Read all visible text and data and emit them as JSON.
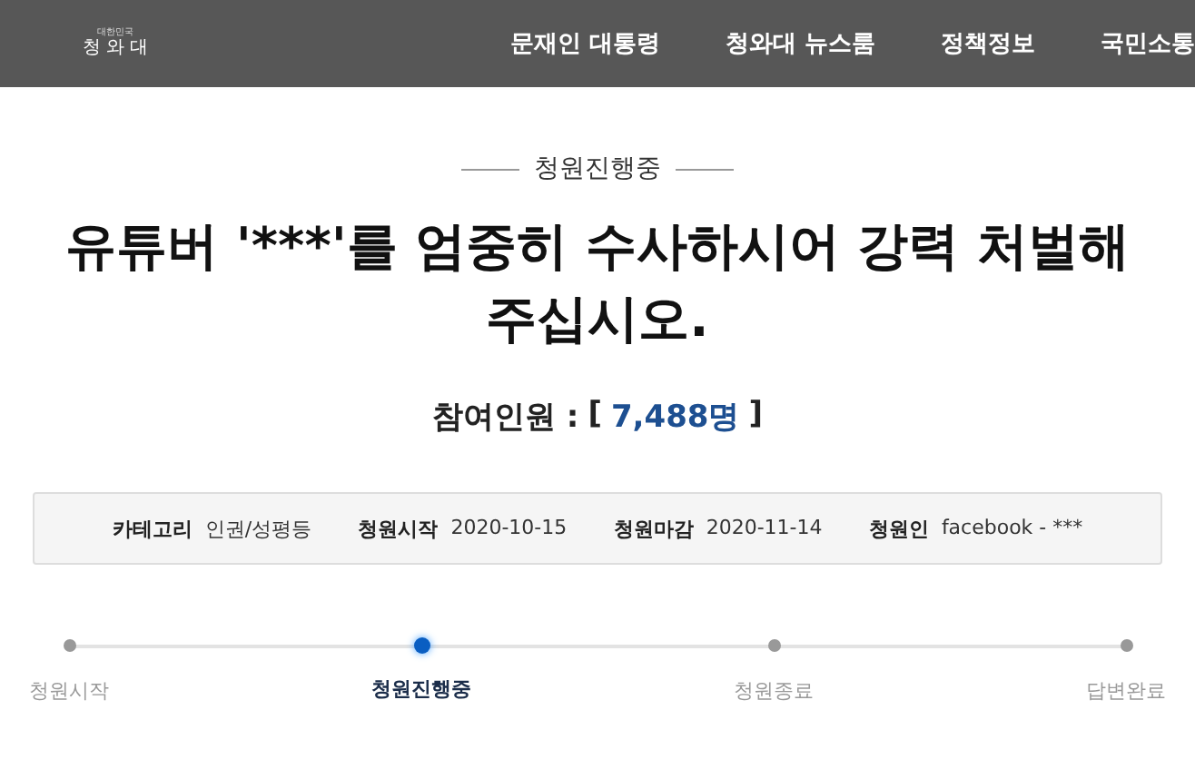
{
  "header": {
    "logo": {
      "top": "대한민국",
      "name": "청 와 대"
    },
    "nav": [
      "문재인 대통령",
      "청와대 뉴스룸",
      "정책정보",
      "국민소통"
    ]
  },
  "status": "청원진행중",
  "title": "유튜버 '***'를 엄중히 수사하시어 강력 처벌해 주십시오.",
  "participants": {
    "label": "참여인원 :",
    "open": "[",
    "count": "7,488명",
    "close": "]"
  },
  "info": [
    {
      "label": "카테고리",
      "value": "인권/성평등"
    },
    {
      "label": "청원시작",
      "value": "2020-10-15"
    },
    {
      "label": "청원마감",
      "value": "2020-11-14"
    },
    {
      "label": "청원인",
      "value": "facebook - ***"
    }
  ],
  "steps": [
    {
      "label": "청원시작",
      "selected": false
    },
    {
      "label": "청원진행중",
      "selected": true
    },
    {
      "label": "청원종료",
      "selected": false
    },
    {
      "label": "답변완료",
      "selected": false
    }
  ]
}
